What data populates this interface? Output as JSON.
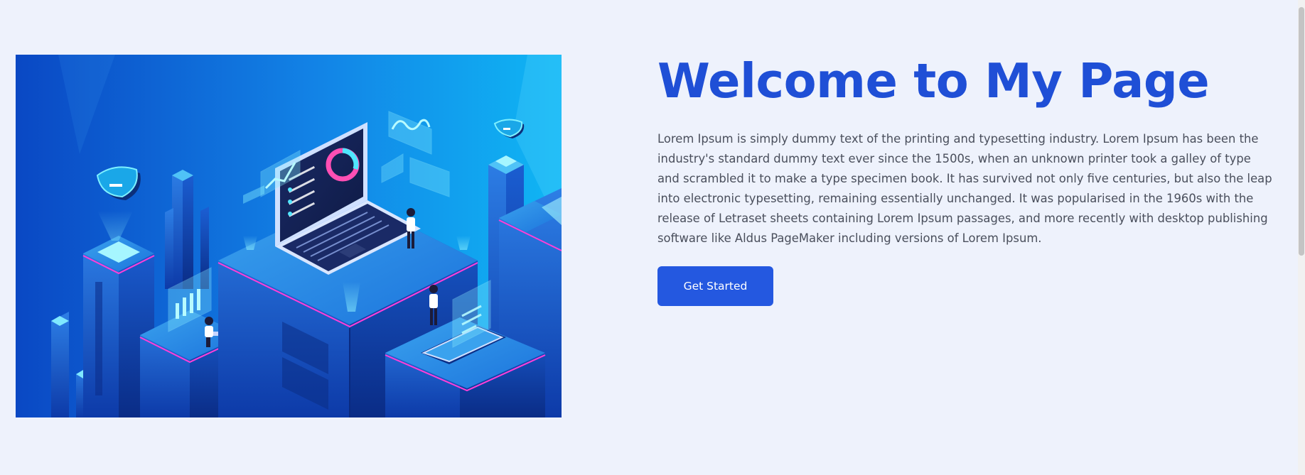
{
  "hero": {
    "title": "Welcome to My Page",
    "description": "Lorem Ipsum is simply dummy text of the printing and typesetting industry. Lorem Ipsum has been the industry's standard dummy text ever since the 1500s, when an unknown printer took a galley of type and scrambled it to make a type specimen book. It has survived not only five centuries, but also the leap into electronic typesetting, remaining essentially unchanged. It was popularised in the 1960s with the release of Letraset sheets containing Lorem Ipsum passages, and more recently with desktop publishing software like Aldus PageMaker including versions of Lorem Ipsum.",
    "cta_label": "Get Started",
    "illustration": "isometric-tech-city-illustration"
  },
  "colors": {
    "page_background": "#eef2fc",
    "title": "#1f4fd6",
    "body_text": "#4a4f5c",
    "button": "#2458e0",
    "button_text": "#ffffff",
    "illustration_dark": "#0a3fb0",
    "illustration_light": "#19b8f5",
    "accent_magenta": "#ff3fd8"
  }
}
